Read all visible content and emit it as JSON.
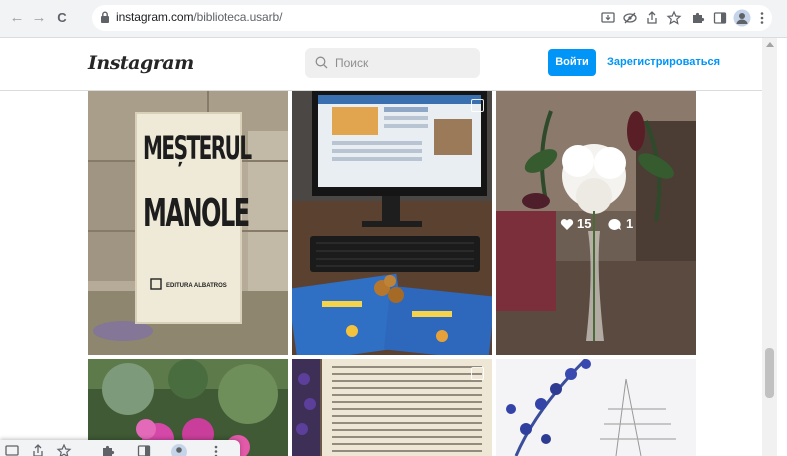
{
  "browser": {
    "url_domain": "instagram.com",
    "url_path": "/biblioteca.usarb/",
    "nav": {
      "back": "←",
      "forward": "→",
      "reload": "C"
    }
  },
  "header": {
    "logo": "Instagram",
    "search_placeholder": "Поиск",
    "login_label": "Войти",
    "register_label": "Зарегистрироваться"
  },
  "posts": [
    {
      "kind": "book-cover",
      "cover_line1": "MEȘTERUL",
      "cover_line2": "MANOLE",
      "publisher": "EDITURA ALBATROS"
    },
    {
      "kind": "computer-desk"
    },
    {
      "kind": "flower-vase",
      "likes": "15",
      "comments": "1"
    },
    {
      "kind": "garden-flowers"
    },
    {
      "kind": "open-book"
    },
    {
      "kind": "lavender-text"
    }
  ],
  "colors": {
    "accent": "#0095f6",
    "text": "#262626"
  }
}
